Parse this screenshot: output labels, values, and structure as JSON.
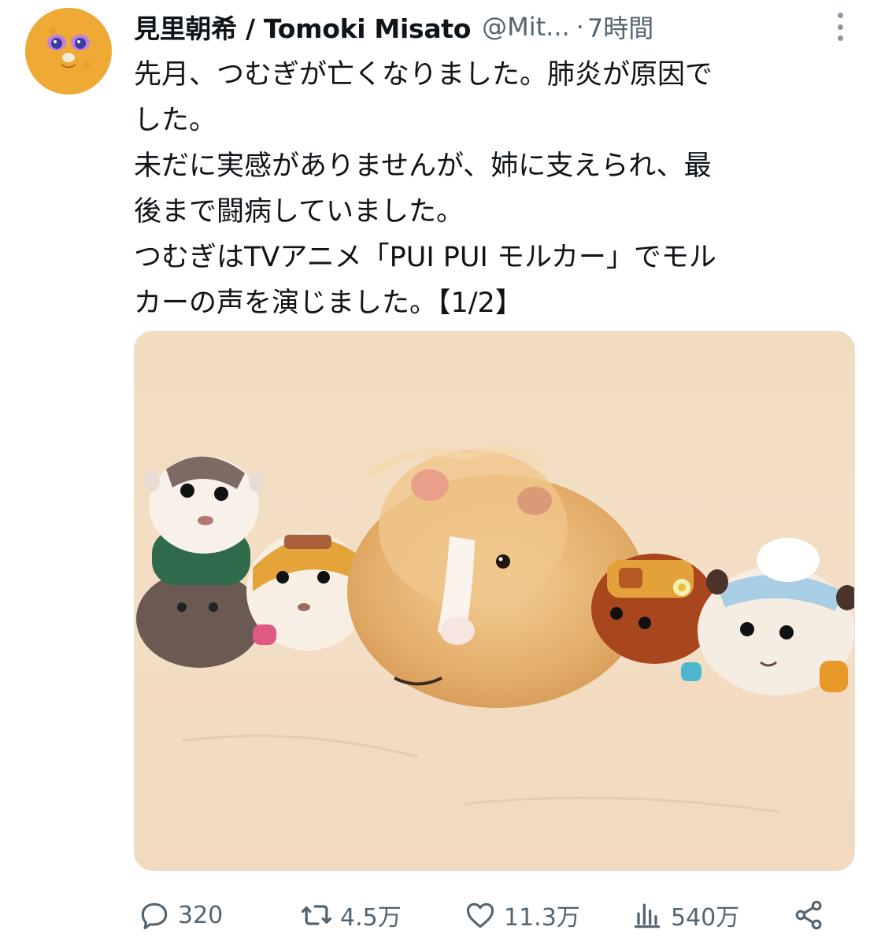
{
  "author": {
    "display_name": "見里朝希 / Tomoki Misato",
    "handle": "@Mit...",
    "separator": "·",
    "time": "7時間"
  },
  "tweet": {
    "lines": [
      "先月、つむぎが亡くなりました。肺炎が原因で",
      "した。",
      "未だに実感がありませんが、姉に支えられ、最",
      "後まで闘病していました。",
      "つむぎはTVアニメ「PUI PUI モルカー」でモル",
      "カーの声を演じました。【1/2】"
    ]
  },
  "actions": {
    "reply_count": "320",
    "retweet_count": "4.5万",
    "like_count": "11.3万",
    "view_count": "540万"
  },
  "icons": {
    "reply": "reply-icon",
    "retweet": "retweet-icon",
    "like": "heart-icon",
    "views": "views-icon",
    "share": "share-icon",
    "more": "more-icon"
  },
  "colors": {
    "text_primary": "#0f1419",
    "text_secondary": "#536471",
    "background": "#ffffff"
  }
}
